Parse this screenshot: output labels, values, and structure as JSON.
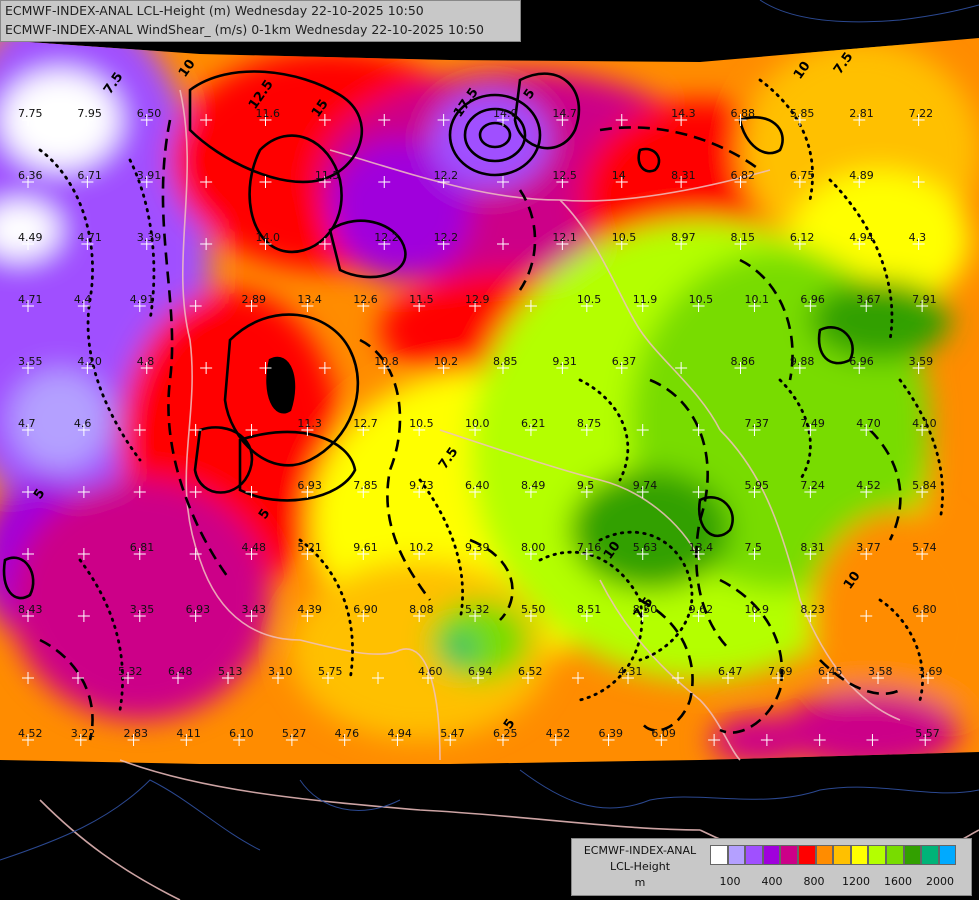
{
  "header": {
    "line1": "ECMWF-INDEX-ANAL LCL-Height (m) Wednesday 22-10-2025 10:50",
    "line2": "ECMWF-INDEX-ANAL WindShear_ (m/s) 0-1km Wednesday 22-10-2025 10:50"
  },
  "legend": {
    "title1": "ECMWF-INDEX-ANAL",
    "title2": "LCL-Height",
    "unit": "m",
    "colors": [
      "#ffffff",
      "#b4a0ff",
      "#a050ff",
      "#a000dc",
      "#cc0088",
      "#ff0000",
      "#ff8c00",
      "#ffc000",
      "#ffff00",
      "#b4ff00",
      "#78dc00",
      "#32a000",
      "#00b478",
      "#00aaff"
    ],
    "ticks": [
      "100",
      "400",
      "800",
      "1200",
      "1600",
      "2000"
    ]
  },
  "contour_labels": [
    "7.5",
    "10",
    "12.5",
    "15",
    "17.5",
    "5",
    "10",
    "7.5",
    "5",
    "10",
    "7.5",
    "5",
    "10",
    "7.5",
    "5"
  ],
  "grid_values": [
    [
      "7.75",
      "7.95",
      "6.50",
      "",
      "11.6",
      "",
      "",
      "",
      "14.0",
      "14.7",
      "",
      "14.3",
      "6.88",
      "5.85",
      "2.81",
      "7.22"
    ],
    [
      "6.36",
      "6.71",
      "3.91",
      "",
      "",
      "11.5",
      "",
      "12.2",
      "",
      "12.5",
      "14",
      "8.31",
      "6.82",
      "6.75",
      "4.89",
      ""
    ],
    [
      "4.49",
      "4.71",
      "3.39",
      "",
      "14.0",
      "",
      "12.2",
      "12.2",
      "",
      "12.1",
      "10.5",
      "8.97",
      "8.15",
      "6.12",
      "4.94",
      "4.3"
    ],
    [
      "4.71",
      "4.4",
      "4.91",
      "",
      "2.89",
      "13.4",
      "12.6",
      "11.5",
      "12.9",
      "",
      "10.5",
      "11.9",
      "10.5",
      "10.1",
      "6.96",
      "3.67",
      "7.91"
    ],
    [
      "3.55",
      "4.20",
      "4.8",
      "",
      "",
      "",
      "10.8",
      "10.2",
      "8.85",
      "9.31",
      "6.37",
      "",
      "8.86",
      "9.88",
      "6.96",
      "3.59"
    ],
    [
      "4.7",
      "4.6",
      "",
      "",
      "",
      "11.3",
      "12.7",
      "10.5",
      "10.0",
      "6.21",
      "8.75",
      "",
      "",
      "7.37",
      "7.49",
      "4.70",
      "4.10"
    ],
    [
      "",
      "",
      "",
      "",
      "",
      "6.93",
      "7.85",
      "9.73",
      "6.40",
      "8.49",
      "9.5",
      "9.74",
      "",
      "5.95",
      "7.24",
      "4.52",
      "5.84"
    ],
    [
      "",
      "",
      "6.81",
      "",
      "4.48",
      "5.21",
      "9.61",
      "10.2",
      "9.39",
      "8.00",
      "7.16",
      "5.63",
      "13.4",
      "7.5",
      "8.31",
      "3.77",
      "5.74"
    ],
    [
      "8.43",
      "",
      "3.35",
      "6.93",
      "3.43",
      "4.39",
      "6.90",
      "8.08",
      "5.32",
      "5.50",
      "8.51",
      "8.50",
      "9.62",
      "10.9",
      "8.23",
      "",
      "6.80"
    ],
    [
      "",
      "",
      "5.32",
      "6.48",
      "5.13",
      "3.10",
      "5.75",
      "",
      "4.60",
      "6.94",
      "6.52",
      "",
      "4.31",
      "",
      "6.47",
      "7.69",
      "6.45",
      "3.58",
      "3.69"
    ],
    [
      "4.52",
      "3.22",
      "2.83",
      "4.11",
      "6.10",
      "5.27",
      "4.76",
      "4.94",
      "5.47",
      "6.25",
      "4.52",
      "6.39",
      "6.09",
      "",
      "",
      "",
      "",
      "5.57"
    ]
  ]
}
